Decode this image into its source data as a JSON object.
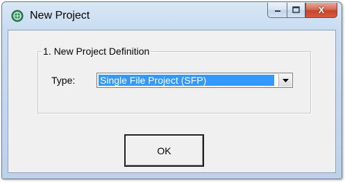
{
  "window": {
    "title": "New Project",
    "icon": "globe-app-icon",
    "caption": {
      "minimize_icon": "minimize-icon",
      "maximize_icon": "maximize-icon",
      "close_icon": "close-icon",
      "close_glyph": "X"
    }
  },
  "group": {
    "legend": "1. New Project Definition"
  },
  "type_field": {
    "label": "Type:",
    "selected_value": "Single File Project (SFP)"
  },
  "buttons": {
    "ok_label": "OK"
  },
  "colors": {
    "selection": "#3399ff",
    "close_button": "#c7432b",
    "dialog_background": "#f0f0f0"
  }
}
